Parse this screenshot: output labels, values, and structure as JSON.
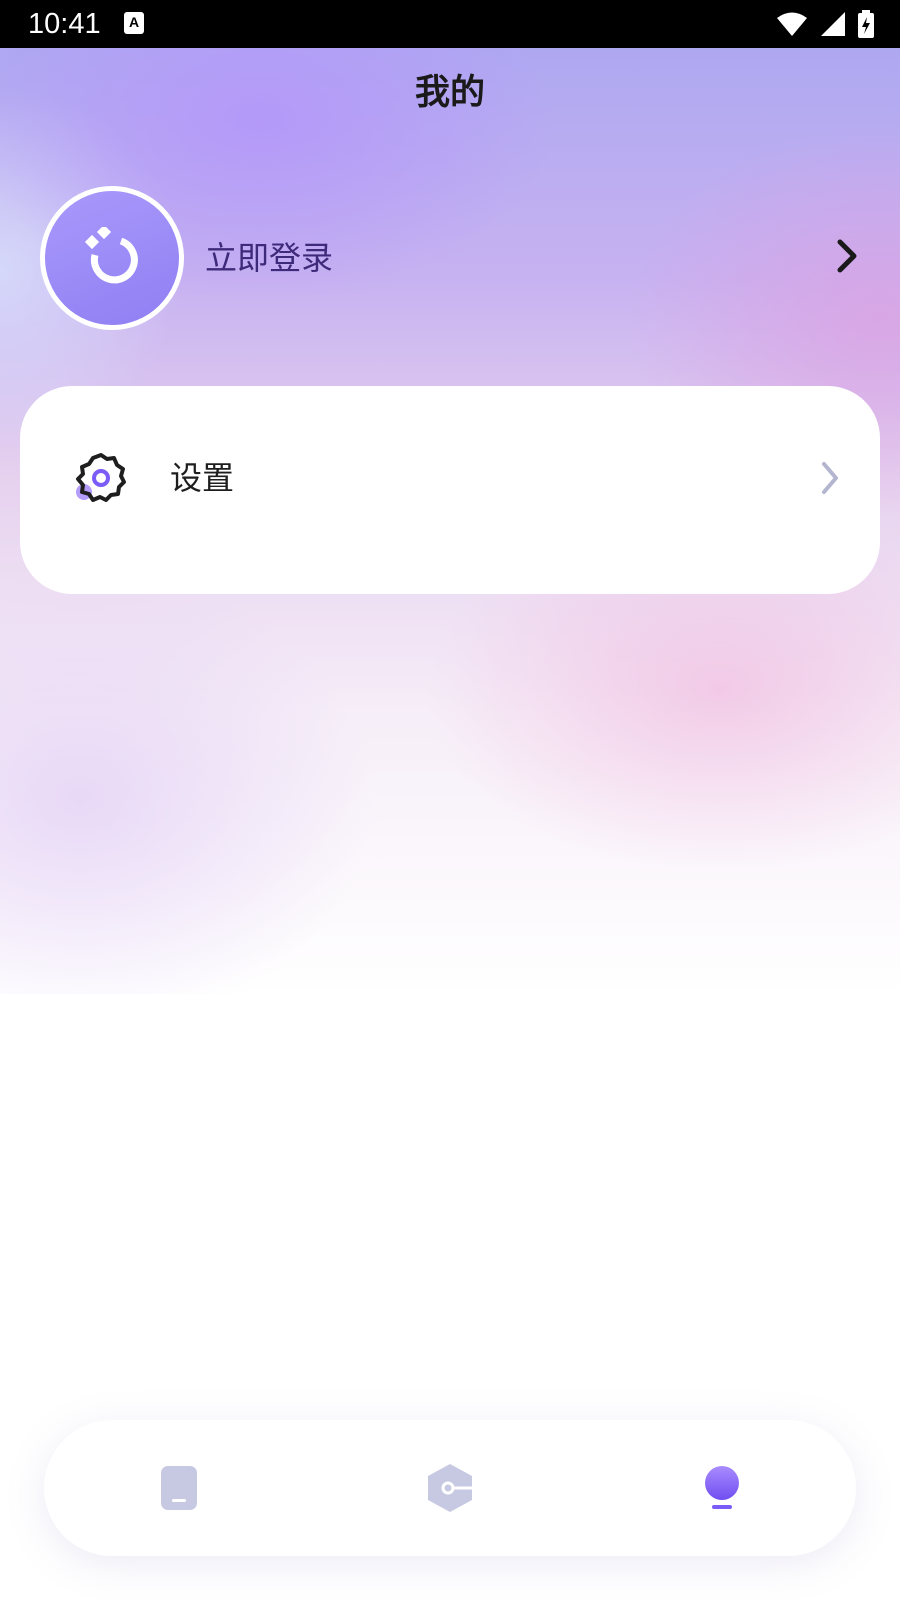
{
  "status_bar": {
    "time": "10:41",
    "notification_icon": "a-keyboard-icon",
    "icons": [
      "wifi-icon",
      "cell-signal-icon",
      "battery-charging-icon"
    ],
    "background": "#000000"
  },
  "header": {
    "title": "我的"
  },
  "profile": {
    "avatar_icon": "user-avatar-icon",
    "login_label": "立即登录",
    "chevron_icon": "chevron-right-icon"
  },
  "menu": {
    "items": [
      {
        "label": "设置",
        "icon": "gear-icon",
        "chevron": "chevron-right-icon"
      }
    ]
  },
  "tab_bar": {
    "items": [
      {
        "icon": "phone-tab-icon",
        "active": false
      },
      {
        "icon": "hexagon-key-tab-icon",
        "active": false
      },
      {
        "icon": "profile-tab-icon",
        "active": true
      }
    ]
  },
  "colors": {
    "accent": "#8b6ff3",
    "inactive_icon": "#c7c9e3",
    "login_text": "#3e2a7a"
  }
}
